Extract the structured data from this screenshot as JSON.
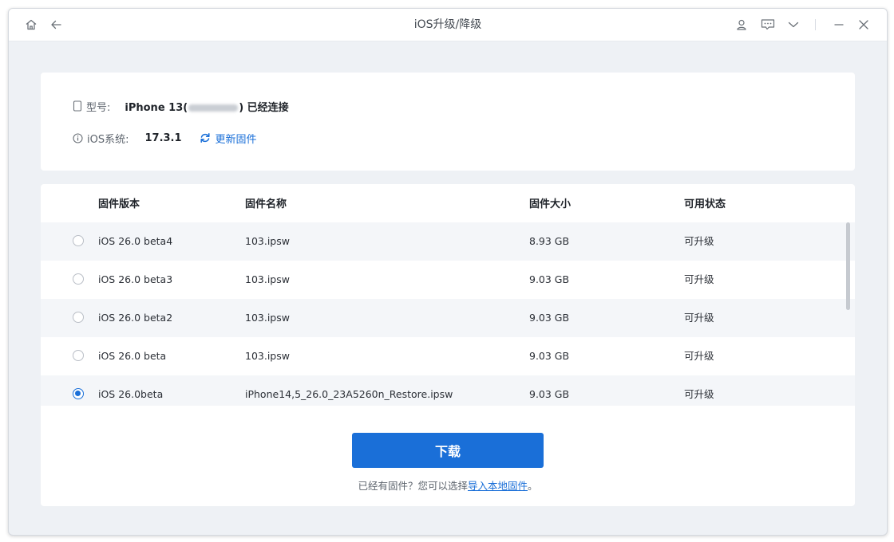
{
  "window": {
    "title": "iOS升级/降级",
    "icons": [
      "home-icon",
      "back-arrow-icon",
      "user-icon",
      "feedback-icon",
      "chevron-down-icon",
      "minimize-icon",
      "close-icon"
    ]
  },
  "device": {
    "model_label": "型号:",
    "model_value_prefix": "iPhone 13(",
    "model_value_suffix": ") 已经连接",
    "ios_label": "iOS系统:",
    "ios_value": "17.3.1",
    "update_link": "更新固件"
  },
  "table": {
    "headers": {
      "version": "固件版本",
      "name": "固件名称",
      "size": "固件大小",
      "status": "可用状态"
    },
    "rows": [
      {
        "version": "iOS 26.0 beta4",
        "name": "103.ipsw",
        "size": "8.93 GB",
        "status": "可升级",
        "selected": false
      },
      {
        "version": "iOS 26.0 beta3",
        "name": "103.ipsw",
        "size": "9.03 GB",
        "status": "可升级",
        "selected": false
      },
      {
        "version": "iOS 26.0 beta2",
        "name": "103.ipsw",
        "size": "9.03 GB",
        "status": "可升级",
        "selected": false
      },
      {
        "version": "iOS 26.0 beta",
        "name": "103.ipsw",
        "size": "9.03 GB",
        "status": "可升级",
        "selected": false
      },
      {
        "version": "iOS 26.0beta",
        "name": "iPhone14,5_26.0_23A5260n_Restore.ipsw",
        "size": "9.03 GB",
        "status": "可升级",
        "selected": true
      }
    ]
  },
  "actions": {
    "download_label": "下载",
    "note_prefix": "已经有固件？您可以选择",
    "import_link": "导入本地固件",
    "note_suffix": "。"
  },
  "colors": {
    "accent": "#1a6fd8",
    "background": "#eef1f5"
  }
}
